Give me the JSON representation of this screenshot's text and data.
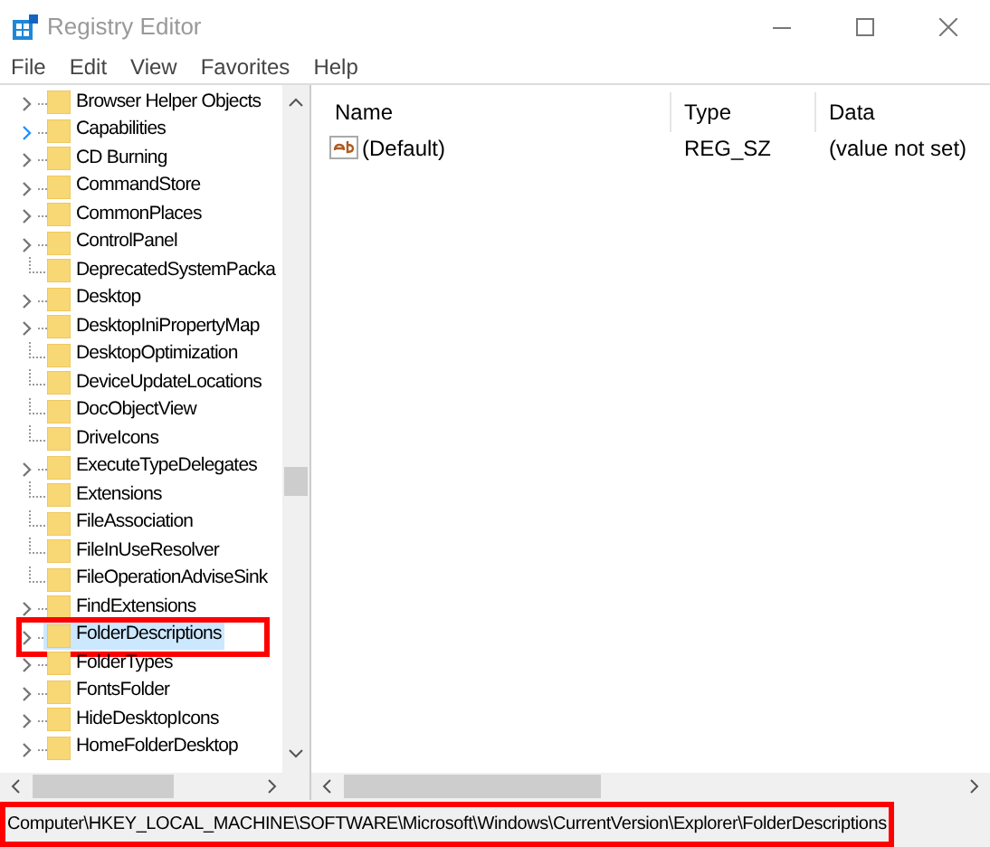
{
  "window": {
    "title": "Registry Editor"
  },
  "menu": [
    "File",
    "Edit",
    "View",
    "Favorites",
    "Help"
  ],
  "tree": [
    {
      "label": "Browser Helper Objects",
      "expandable": true,
      "hovered": false,
      "selected": false,
      "annotated": false
    },
    {
      "label": "Capabilities",
      "expandable": true,
      "hovered": true,
      "selected": false,
      "annotated": false
    },
    {
      "label": "CD Burning",
      "expandable": true,
      "hovered": false,
      "selected": false,
      "annotated": false
    },
    {
      "label": "CommandStore",
      "expandable": true,
      "hovered": false,
      "selected": false,
      "annotated": false
    },
    {
      "label": "CommonPlaces",
      "expandable": true,
      "hovered": false,
      "selected": false,
      "annotated": false
    },
    {
      "label": "ControlPanel",
      "expandable": true,
      "hovered": false,
      "selected": false,
      "annotated": false
    },
    {
      "label": "DeprecatedSystemPacka",
      "expandable": false,
      "hovered": false,
      "selected": false,
      "annotated": false
    },
    {
      "label": "Desktop",
      "expandable": true,
      "hovered": false,
      "selected": false,
      "annotated": false
    },
    {
      "label": "DesktopIniPropertyMap",
      "expandable": true,
      "hovered": false,
      "selected": false,
      "annotated": false
    },
    {
      "label": "DesktopOptimization",
      "expandable": false,
      "hovered": false,
      "selected": false,
      "annotated": false
    },
    {
      "label": "DeviceUpdateLocations",
      "expandable": false,
      "hovered": false,
      "selected": false,
      "annotated": false
    },
    {
      "label": "DocObjectView",
      "expandable": false,
      "hovered": false,
      "selected": false,
      "annotated": false
    },
    {
      "label": "DriveIcons",
      "expandable": false,
      "hovered": false,
      "selected": false,
      "annotated": false
    },
    {
      "label": "ExecuteTypeDelegates",
      "expandable": true,
      "hovered": false,
      "selected": false,
      "annotated": false
    },
    {
      "label": "Extensions",
      "expandable": false,
      "hovered": false,
      "selected": false,
      "annotated": false
    },
    {
      "label": "FileAssociation",
      "expandable": false,
      "hovered": false,
      "selected": false,
      "annotated": false
    },
    {
      "label": "FileInUseResolver",
      "expandable": false,
      "hovered": false,
      "selected": false,
      "annotated": false
    },
    {
      "label": "FileOperationAdviseSink",
      "expandable": false,
      "hovered": false,
      "selected": false,
      "annotated": false
    },
    {
      "label": "FindExtensions",
      "expandable": true,
      "hovered": false,
      "selected": false,
      "annotated": false
    },
    {
      "label": "FolderDescriptions",
      "expandable": true,
      "hovered": false,
      "selected": true,
      "annotated": true
    },
    {
      "label": "FolderTypes",
      "expandable": true,
      "hovered": false,
      "selected": false,
      "annotated": false
    },
    {
      "label": "FontsFolder",
      "expandable": true,
      "hovered": false,
      "selected": false,
      "annotated": false
    },
    {
      "label": "HideDesktopIcons",
      "expandable": true,
      "hovered": false,
      "selected": false,
      "annotated": false
    },
    {
      "label": "HomeFolderDesktop",
      "expandable": true,
      "hovered": false,
      "selected": false,
      "annotated": false
    }
  ],
  "values": {
    "columns": [
      "Name",
      "Type",
      "Data"
    ],
    "rows": [
      {
        "name": "(Default)",
        "type": "REG_SZ",
        "data": "(value not set)"
      }
    ]
  },
  "status_bar": {
    "path": "Computer\\HKEY_LOCAL_MACHINE\\SOFTWARE\\Microsoft\\Windows\\CurrentVersion\\Explorer\\FolderDescriptions",
    "annotated": true
  }
}
